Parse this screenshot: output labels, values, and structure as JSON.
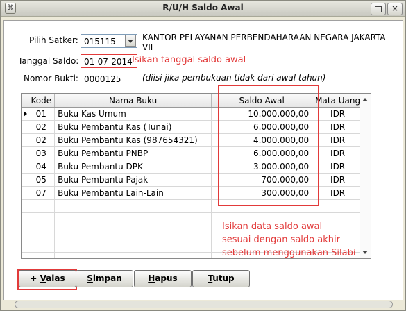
{
  "window": {
    "title": "R/U/H Saldo Awal",
    "close_glyph": "×"
  },
  "form": {
    "satker_label": "Pilih Satker:",
    "satker_value": "015115",
    "satker_name_line1": "KANTOR PELAYANAN PERBENDAHARAAN NEGARA JAKARTA",
    "satker_name_line2": "VII",
    "tanggal_label": "Tanggal Saldo:",
    "tanggal_value": "01-07-2014",
    "tanggal_hint": "Isikan tanggal saldo awal",
    "nomor_label": "Nomor Bukti:",
    "nomor_value": "0000125",
    "nomor_note": "(diisi jika pembukuan tidak dari awal tahun)"
  },
  "table": {
    "columns": [
      "Kode",
      "Nama Buku",
      "Saldo Awal",
      "Mata Uang"
    ],
    "rows": [
      {
        "kode": "01",
        "nama": "Buku Kas Umum",
        "saldo": "10.000.000,00",
        "mata_uang": "IDR"
      },
      {
        "kode": "02",
        "nama": "Buku Pembantu Kas (Tunai)",
        "saldo": "6.000.000,00",
        "mata_uang": "IDR"
      },
      {
        "kode": "02",
        "nama": "Buku Pembantu Kas (987654321)",
        "saldo": "4.000.000,00",
        "mata_uang": "IDR"
      },
      {
        "kode": "03",
        "nama": "Buku Pembantu PNBP",
        "saldo": "6.000.000,00",
        "mata_uang": "IDR"
      },
      {
        "kode": "04",
        "nama": "Buku Pembantu DPK",
        "saldo": "3.000.000,00",
        "mata_uang": "IDR"
      },
      {
        "kode": "05",
        "nama": "Buku Pembantu Pajak",
        "saldo": "700.000,00",
        "mata_uang": "IDR"
      },
      {
        "kode": "07",
        "nama": "Buku Pembantu Lain-Lain",
        "saldo": "300.000,00",
        "mata_uang": "IDR"
      }
    ],
    "empty_rows": 5
  },
  "annotation": {
    "line1": "Isikan data saldo awal",
    "line2": "sesuai dengan saldo akhir",
    "line3": "sebelum menggunakan Silabi"
  },
  "buttons": {
    "valas_prefix": "+ ",
    "valas_key": "V",
    "valas_rest": "alas",
    "simpan_key": "S",
    "simpan_rest": "impan",
    "hapus_key": "H",
    "hapus_rest": "apus",
    "tutup_key": "T",
    "tutup_rest": "utup"
  },
  "colors": {
    "annotation_red": "#e23a3a",
    "panel_bg": "#ffffff",
    "window_bg": "#ece9d8"
  },
  "icons": [
    "app-menu-icon",
    "maximize-icon",
    "close-icon",
    "dropdown-arrow-icon",
    "row-pointer-icon",
    "scroll-up-icon",
    "scroll-down-icon"
  ]
}
